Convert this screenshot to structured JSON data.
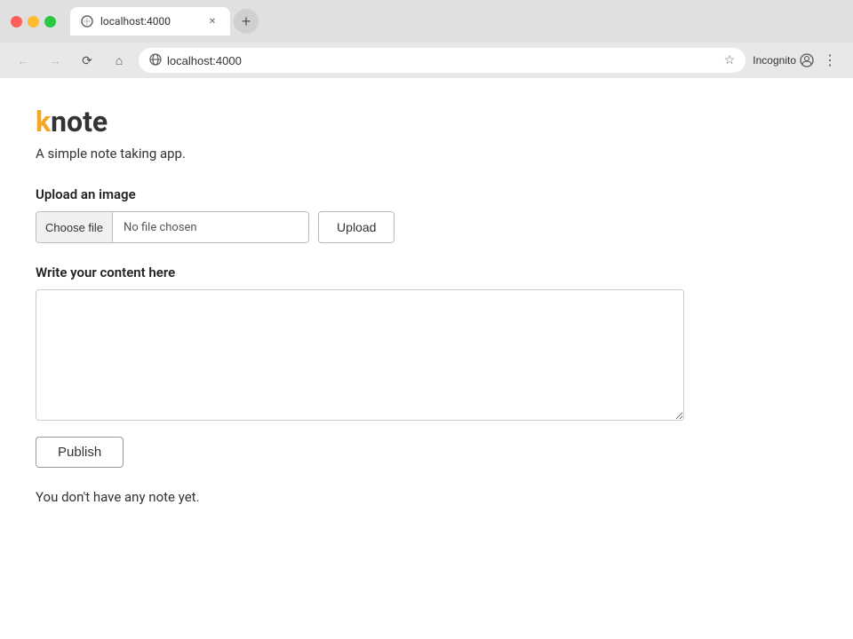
{
  "browser": {
    "tab": {
      "url": "localhost:4000",
      "title": "localhost:4000"
    },
    "address_bar": {
      "url": "localhost:4000"
    },
    "toolbar": {
      "profile_label": "Incognito"
    }
  },
  "app": {
    "logo": {
      "k": "k",
      "rest": "note"
    },
    "tagline": "A simple note taking app.",
    "upload_section": {
      "label": "Upload an image",
      "choose_file_label": "Choose file",
      "file_status": "No file chosen",
      "upload_button_label": "Upload"
    },
    "content_section": {
      "label": "Write your content here",
      "textarea_placeholder": ""
    },
    "publish_button_label": "Publish",
    "empty_state_text": "You don't have any note yet."
  }
}
